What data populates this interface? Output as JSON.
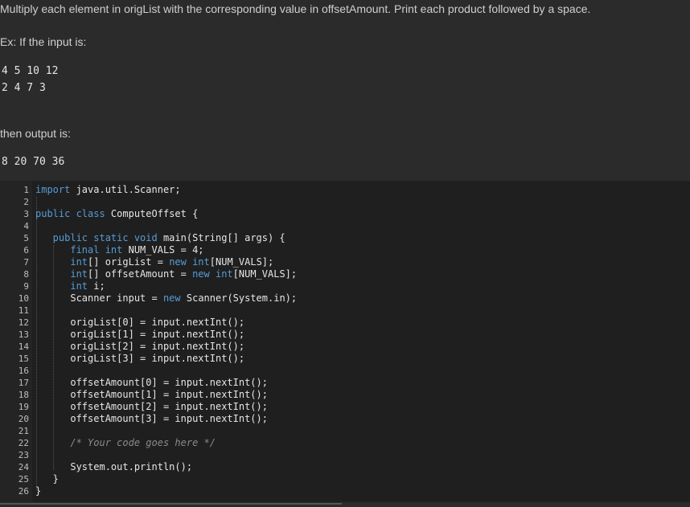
{
  "prompt": {
    "instruction": "Multiply each element in origList with the corresponding value in offsetAmount. Print each product followed by a space.",
    "example_intro": "Ex: If the input is:",
    "input_line1": "4 5 10 12",
    "input_line2": "2 4 7 3",
    "output_intro": "then output is:",
    "output_line": "8 20 70 36"
  },
  "editor": {
    "lines": [
      {
        "n": "1",
        "segs": [
          {
            "t": "import",
            "c": "kw"
          },
          {
            "t": " java.util.Scanner;",
            "c": ""
          }
        ]
      },
      {
        "n": "2",
        "segs": []
      },
      {
        "n": "3",
        "segs": [
          {
            "t": "public class",
            "c": "kw"
          },
          {
            "t": " ComputeOffset {",
            "c": ""
          }
        ]
      },
      {
        "n": "4",
        "segs": []
      },
      {
        "n": "5",
        "segs": [
          {
            "t": "   public static void",
            "c": "kw"
          },
          {
            "t": " main(String[] args) {",
            "c": ""
          }
        ]
      },
      {
        "n": "6",
        "segs": [
          {
            "t": "      final int",
            "c": "kw"
          },
          {
            "t": " NUM_VALS = 4;",
            "c": ""
          }
        ]
      },
      {
        "n": "7",
        "segs": [
          {
            "t": "      int",
            "c": "kw"
          },
          {
            "t": "[] origList = ",
            "c": ""
          },
          {
            "t": "new int",
            "c": "kw"
          },
          {
            "t": "[NUM_VALS];",
            "c": ""
          }
        ]
      },
      {
        "n": "8",
        "segs": [
          {
            "t": "      int",
            "c": "kw"
          },
          {
            "t": "[] offsetAmount = ",
            "c": ""
          },
          {
            "t": "new int",
            "c": "kw"
          },
          {
            "t": "[NUM_VALS];",
            "c": ""
          }
        ]
      },
      {
        "n": "9",
        "segs": [
          {
            "t": "      int",
            "c": "kw"
          },
          {
            "t": " i;",
            "c": ""
          }
        ]
      },
      {
        "n": "10",
        "segs": [
          {
            "t": "      Scanner input = ",
            "c": ""
          },
          {
            "t": "new",
            "c": "kw"
          },
          {
            "t": " Scanner(System.in);",
            "c": ""
          }
        ]
      },
      {
        "n": "11",
        "segs": []
      },
      {
        "n": "12",
        "segs": [
          {
            "t": "      origList[0] = input.nextInt();",
            "c": ""
          }
        ]
      },
      {
        "n": "13",
        "segs": [
          {
            "t": "      origList[1] = input.nextInt();",
            "c": ""
          }
        ]
      },
      {
        "n": "14",
        "segs": [
          {
            "t": "      origList[2] = input.nextInt();",
            "c": ""
          }
        ]
      },
      {
        "n": "15",
        "segs": [
          {
            "t": "      origList[3] = input.nextInt();",
            "c": ""
          }
        ]
      },
      {
        "n": "16",
        "segs": []
      },
      {
        "n": "17",
        "segs": [
          {
            "t": "      offsetAmount[0] = input.nextInt();",
            "c": ""
          }
        ]
      },
      {
        "n": "18",
        "segs": [
          {
            "t": "      offsetAmount[1] = input.nextInt();",
            "c": ""
          }
        ]
      },
      {
        "n": "19",
        "segs": [
          {
            "t": "      offsetAmount[2] = input.nextInt();",
            "c": ""
          }
        ]
      },
      {
        "n": "20",
        "segs": [
          {
            "t": "      offsetAmount[3] = input.nextInt();",
            "c": ""
          }
        ]
      },
      {
        "n": "21",
        "segs": []
      },
      {
        "n": "22",
        "segs": [
          {
            "t": "      /* Your code goes here */",
            "c": "cm"
          }
        ]
      },
      {
        "n": "23",
        "segs": []
      },
      {
        "n": "24",
        "segs": [
          {
            "t": "      System.out.println();",
            "c": ""
          }
        ]
      },
      {
        "n": "25",
        "segs": [
          {
            "t": "   }",
            "c": ""
          }
        ]
      },
      {
        "n": "26",
        "segs": [
          {
            "t": "}",
            "c": ""
          }
        ]
      }
    ]
  }
}
